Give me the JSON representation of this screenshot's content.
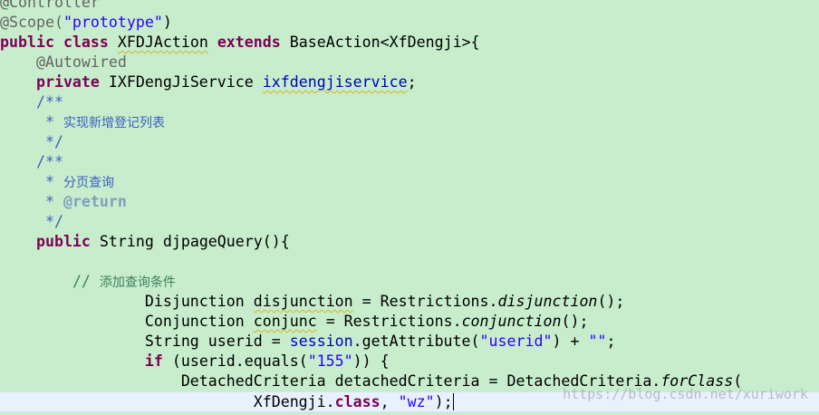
{
  "editor": {
    "line01": {
      "ann": "@Controller"
    },
    "line02": {
      "ann": "@Scope(",
      "str": "\"prototype\"",
      "close": ")"
    },
    "line03": {
      "kw1": "public",
      "kw2": "class",
      "name": "XFDJAction",
      "kw3": "extends",
      "rest": "BaseAction<XfDengji>{"
    },
    "line04": {
      "ann": "@Autowired"
    },
    "line05": {
      "kw": "private",
      "type": "IXFDengJiService",
      "field": "ixfdengjiservice",
      "semi": ";"
    },
    "line06": {
      "text": "/**"
    },
    "line07": {
      "star": " * ",
      "text": "实现新增登记列表"
    },
    "line08": {
      "text": " */"
    },
    "line09": {
      "text": "/**"
    },
    "line10": {
      "star": " * ",
      "text": "分页查询"
    },
    "line11": {
      "star": " * ",
      "tag": "@return"
    },
    "line12": {
      "text": " */"
    },
    "line13": {
      "kw": "public",
      "rest": "String djpageQuery(){"
    },
    "line15": {
      "slashes": "//",
      "text": "添加查询条件"
    },
    "line16": {
      "type": "Disjunction",
      "var": "disjunction",
      "mid": "= Restrictions.",
      "method": "disjunction",
      "end": "();"
    },
    "line17": {
      "type": "Conjunction",
      "var": "conjunc",
      "mid": "= Restrictions.",
      "method": "conjunction",
      "end": "();"
    },
    "line18": {
      "type": "String userid =",
      "field": "session",
      "mid": ".getAttribute(",
      "str1": "\"userid\"",
      "plus": ") +",
      "str2": "\"\"",
      "end": ";"
    },
    "line19": {
      "kw": "if",
      "mid": "(userid.equals(",
      "str": "\"155\"",
      "end": ")) {"
    },
    "line20": {
      "pre": "DetachedCriteria detachedCriteria = DetachedCriteria.",
      "method": "forClass",
      "end": "("
    },
    "line21": {
      "type": "XfDengji.",
      "kw": "class",
      "comma": ",",
      "str": "\"wz\"",
      "end": ");"
    }
  },
  "watermark": "https://blog.csdn.net/xuriwork"
}
